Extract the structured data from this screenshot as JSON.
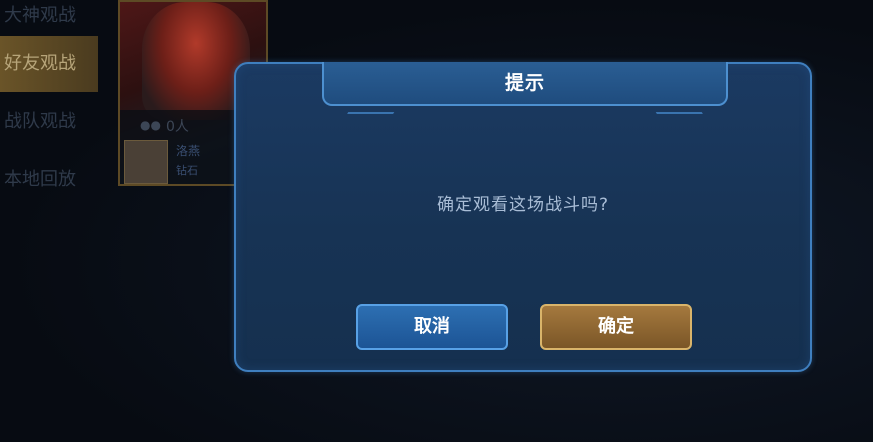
{
  "sidebar": {
    "items": [
      {
        "label": "大神观战"
      },
      {
        "label": "好友观战"
      },
      {
        "label": "战队观战"
      },
      {
        "label": "本地回放"
      }
    ],
    "active_index": 1
  },
  "match_card": {
    "viewer_count": "0人",
    "player_name": "洛燕",
    "player_level": "钻石"
  },
  "dialog": {
    "title": "提示",
    "message": "确定观看这场战斗吗?",
    "cancel_label": "取消",
    "confirm_label": "确定"
  },
  "colors": {
    "dialog_border": "#3f7fbf",
    "dialog_bg": "#1b3a62",
    "cancel_button": "#2d6fb2",
    "confirm_button": "#a5793e",
    "active_tab": "#6a5428"
  }
}
